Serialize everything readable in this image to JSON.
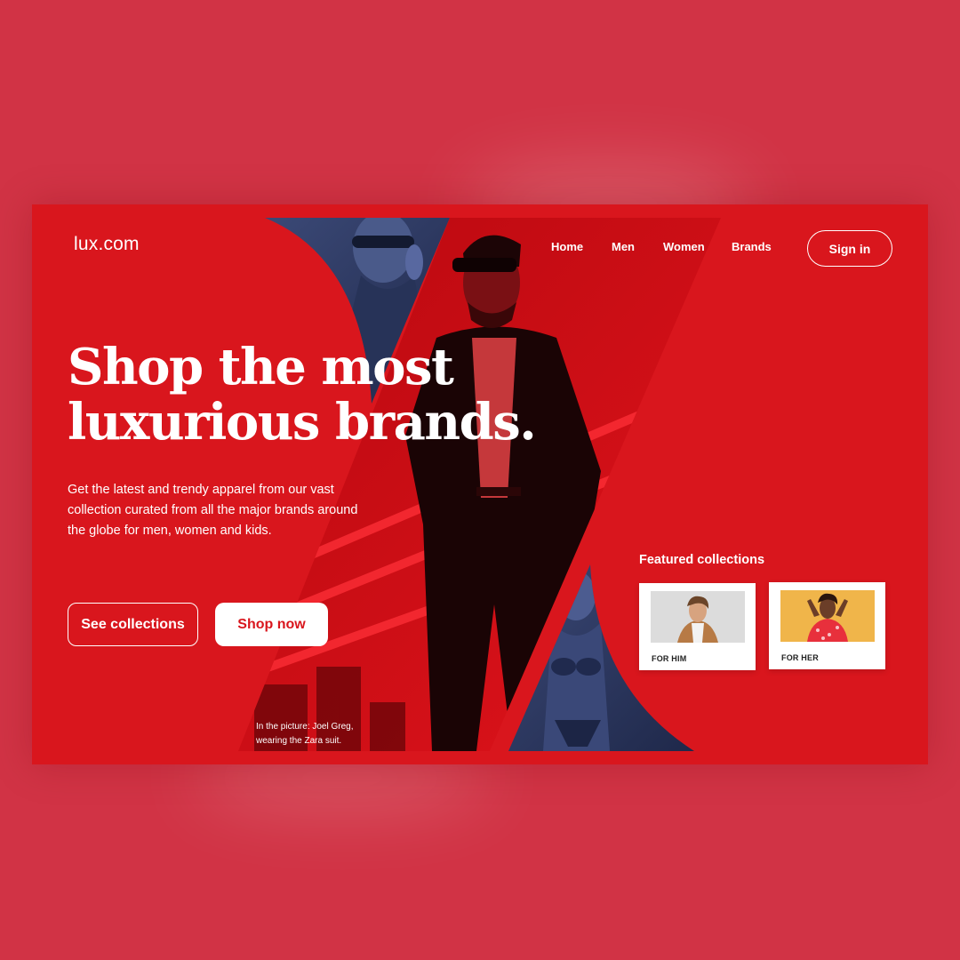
{
  "brand": {
    "logo": "lux.com"
  },
  "nav": {
    "items": [
      {
        "label": "Home"
      },
      {
        "label": "Men"
      },
      {
        "label": "Women"
      },
      {
        "label": "Brands"
      }
    ],
    "signin_label": "Sign in"
  },
  "hero": {
    "headline_line1": "Shop the most",
    "headline_line2": "luxurious brands.",
    "description": "Get the latest and trendy apparel from our vast collection curated from all the major brands around the globe for men, women and kids.",
    "see_collections_label": "See collections",
    "shop_now_label": "Shop now",
    "caption": "In the picture: Joel Greg, wearing the Zara suit."
  },
  "featured": {
    "title": "Featured collections",
    "cards": [
      {
        "label": "FOR HIM"
      },
      {
        "label": "FOR HER"
      }
    ]
  },
  "colors": {
    "page_bg": "#d13345",
    "frame_bg": "#d9161d",
    "accent_white": "#ffffff",
    "photo_blue": "#2e3b62"
  }
}
